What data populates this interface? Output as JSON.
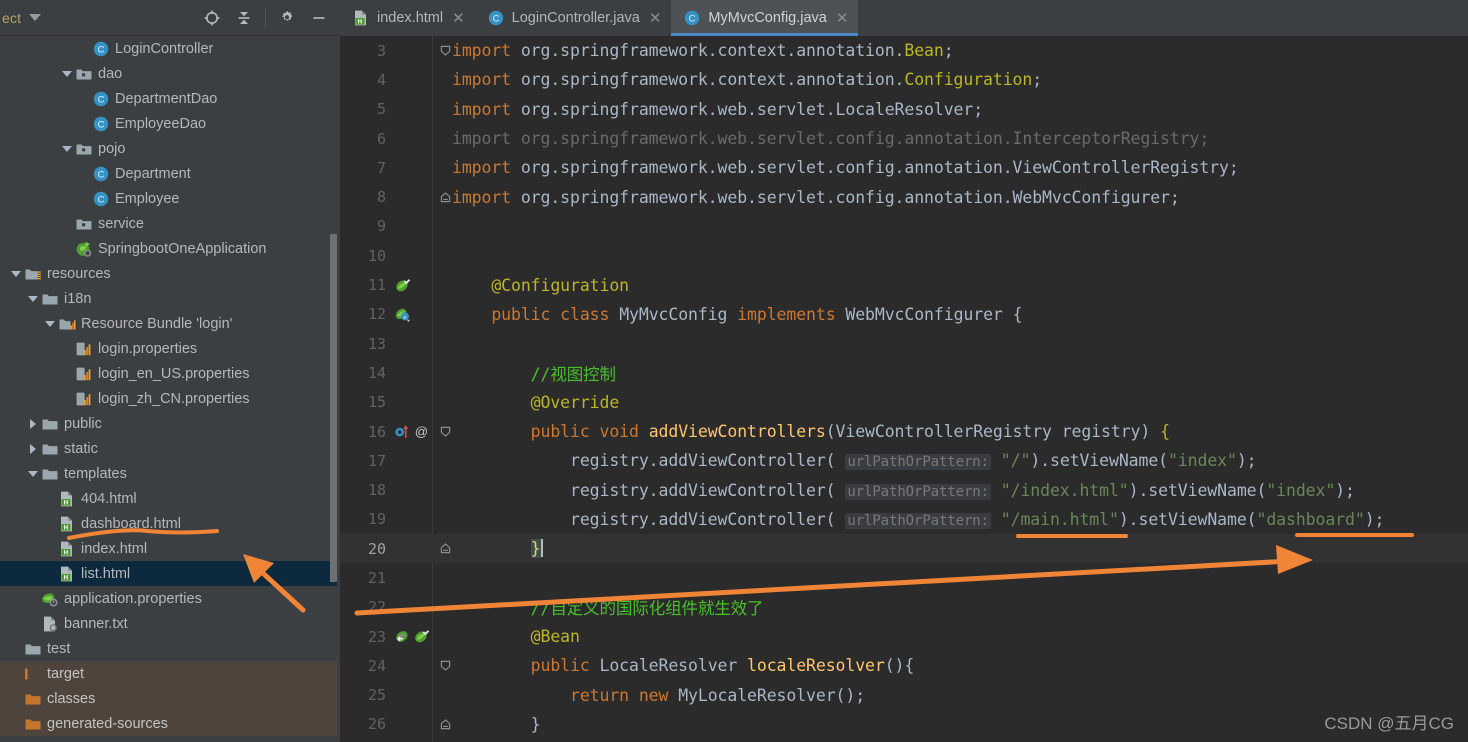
{
  "toolbar": {
    "project_label": "ect",
    "icons": [
      {
        "name": "locate-target-icon",
        "glyph": "locate"
      },
      {
        "name": "collapse-all-icon",
        "glyph": "collapse"
      },
      {
        "name": "settings-gear-icon",
        "glyph": "gear"
      },
      {
        "name": "minimize-icon",
        "glyph": "minimize"
      }
    ]
  },
  "sidebar": {
    "items": [
      {
        "label": "LoginController",
        "indent": 4,
        "twisty": "none",
        "icon": "java-class-icon",
        "state": "normal"
      },
      {
        "label": "dao",
        "indent": 3,
        "twisty": "open",
        "icon": "package-folder-icon",
        "state": "normal"
      },
      {
        "label": "DepartmentDao",
        "indent": 4,
        "twisty": "none",
        "icon": "java-class-icon",
        "state": "normal"
      },
      {
        "label": "EmployeeDao",
        "indent": 4,
        "twisty": "none",
        "icon": "java-class-icon",
        "state": "normal"
      },
      {
        "label": "pojo",
        "indent": 3,
        "twisty": "open",
        "icon": "package-folder-icon",
        "state": "normal"
      },
      {
        "label": "Department",
        "indent": 4,
        "twisty": "none",
        "icon": "java-class-icon",
        "state": "normal"
      },
      {
        "label": "Employee",
        "indent": 4,
        "twisty": "none",
        "icon": "java-class-icon",
        "state": "normal"
      },
      {
        "label": "service",
        "indent": 3,
        "twisty": "none",
        "icon": "package-folder-icon",
        "state": "normal"
      },
      {
        "label": "SpringbootOneApplication",
        "indent": 3,
        "twisty": "none",
        "icon": "spring-app-icon",
        "state": "normal"
      },
      {
        "label": "resources",
        "indent": 0,
        "twisty": "open",
        "icon": "resources-folder-icon",
        "state": "normal"
      },
      {
        "label": "i18n",
        "indent": 1,
        "twisty": "open",
        "icon": "folder-icon",
        "state": "normal"
      },
      {
        "label": "Resource Bundle 'login'",
        "indent": 2,
        "twisty": "open",
        "icon": "resource-bundle-icon",
        "state": "normal"
      },
      {
        "label": "login.properties",
        "indent": 3,
        "twisty": "none",
        "icon": "properties-file-icon",
        "state": "normal"
      },
      {
        "label": "login_en_US.properties",
        "indent": 3,
        "twisty": "none",
        "icon": "properties-file-icon",
        "state": "normal"
      },
      {
        "label": "login_zh_CN.properties",
        "indent": 3,
        "twisty": "none",
        "icon": "properties-file-icon",
        "state": "normal"
      },
      {
        "label": "public",
        "indent": 1,
        "twisty": "closed",
        "icon": "folder-icon",
        "state": "normal"
      },
      {
        "label": "static",
        "indent": 1,
        "twisty": "closed",
        "icon": "folder-icon",
        "state": "normal"
      },
      {
        "label": "templates",
        "indent": 1,
        "twisty": "open",
        "icon": "folder-icon",
        "state": "normal"
      },
      {
        "label": "404.html",
        "indent": 2,
        "twisty": "none",
        "icon": "html-file-icon",
        "state": "normal"
      },
      {
        "label": "dashboard.html",
        "indent": 2,
        "twisty": "none",
        "icon": "html-file-icon",
        "state": "normal"
      },
      {
        "label": "index.html",
        "indent": 2,
        "twisty": "none",
        "icon": "html-file-icon",
        "state": "normal"
      },
      {
        "label": "list.html",
        "indent": 2,
        "twisty": "none",
        "icon": "html-file-icon",
        "state": "selected"
      },
      {
        "label": "application.properties",
        "indent": 1,
        "twisty": "none",
        "icon": "spring-properties-icon",
        "state": "normal"
      },
      {
        "label": "banner.txt",
        "indent": 1,
        "twisty": "none",
        "icon": "text-file-icon",
        "state": "normal"
      },
      {
        "label": "test",
        "indent": 0,
        "twisty": "none",
        "icon": "folder-icon",
        "state": "normal"
      },
      {
        "label": "target",
        "indent": -1,
        "twisty": "none",
        "icon": "excluded-folder-icon",
        "state": "excluded"
      },
      {
        "label": "classes",
        "indent": 0,
        "twisty": "none",
        "icon": "orange-folder-icon",
        "state": "excluded"
      },
      {
        "label": "generated-sources",
        "indent": 0,
        "twisty": "none",
        "icon": "orange-folder-icon",
        "state": "excluded"
      }
    ]
  },
  "tabs": [
    {
      "label": "index.html",
      "icon": "html-file-icon",
      "active": false
    },
    {
      "label": "LoginController.java",
      "icon": "java-class-icon",
      "active": false
    },
    {
      "label": "MyMvcConfig.java",
      "icon": "java-class-icon",
      "active": true
    }
  ],
  "editor": {
    "active_file": "MyMvcConfig.java",
    "caret_line": 20,
    "lines": [
      {
        "n": "3",
        "fold": "start",
        "gutter": [],
        "caret": false,
        "tokens": [
          {
            "t": "import ",
            "c": "kw"
          },
          {
            "t": "org.springframework.context.annotation.",
            "c": "cls"
          },
          {
            "t": "Bean",
            "c": "ann"
          },
          {
            "t": ";",
            "c": "cls"
          }
        ]
      },
      {
        "n": "4",
        "fold": "none",
        "gutter": [],
        "caret": false,
        "tokens": [
          {
            "t": "import ",
            "c": "kw"
          },
          {
            "t": "org.springframework.context.annotation.",
            "c": "cls"
          },
          {
            "t": "Configuration",
            "c": "ann"
          },
          {
            "t": ";",
            "c": "cls"
          }
        ]
      },
      {
        "n": "5",
        "fold": "none",
        "gutter": [],
        "caret": false,
        "tokens": [
          {
            "t": "import ",
            "c": "kw"
          },
          {
            "t": "org.springframework.web.servlet.LocaleResolver;",
            "c": "cls"
          }
        ]
      },
      {
        "n": "6",
        "fold": "none",
        "gutter": [],
        "caret": false,
        "tokens": [
          {
            "t": "import org.springframework.web.servlet.config.annotation.InterceptorRegistry;",
            "c": "dim"
          }
        ]
      },
      {
        "n": "7",
        "fold": "none",
        "gutter": [],
        "caret": false,
        "tokens": [
          {
            "t": "import ",
            "c": "kw"
          },
          {
            "t": "org.springframework.web.servlet.config.annotation.ViewControllerRegistry;",
            "c": "cls"
          }
        ]
      },
      {
        "n": "8",
        "fold": "end",
        "gutter": [],
        "caret": false,
        "tokens": [
          {
            "t": "import ",
            "c": "kw"
          },
          {
            "t": "org.springframework.web.servlet.config.annotation.WebMvcConfigurer;",
            "c": "cls"
          }
        ]
      },
      {
        "n": "9",
        "fold": "none",
        "gutter": [],
        "caret": false,
        "tokens": []
      },
      {
        "n": "10",
        "fold": "none",
        "gutter": [],
        "caret": false,
        "tokens": []
      },
      {
        "n": "11",
        "fold": "none",
        "gutter": [
          "bean-check-icon"
        ],
        "caret": false,
        "tokens": [
          {
            "t": "    ",
            "c": "cls"
          },
          {
            "t": "@Configuration",
            "c": "ann"
          }
        ]
      },
      {
        "n": "12",
        "fold": "none",
        "gutter": [
          "bean-navigate-icon"
        ],
        "caret": false,
        "tokens": [
          {
            "t": "    ",
            "c": "cls"
          },
          {
            "t": "public class ",
            "c": "kw"
          },
          {
            "t": "MyMvcConfig ",
            "c": "cls"
          },
          {
            "t": "implements ",
            "c": "kw"
          },
          {
            "t": "WebMvcConfigurer {",
            "c": "cls"
          }
        ]
      },
      {
        "n": "13",
        "fold": "none",
        "gutter": [],
        "caret": false,
        "tokens": []
      },
      {
        "n": "14",
        "fold": "none",
        "gutter": [],
        "caret": false,
        "tokens": [
          {
            "t": "        ",
            "c": "cls"
          },
          {
            "t": "//视图控制",
            "c": "cmt-green"
          }
        ]
      },
      {
        "n": "15",
        "fold": "none",
        "gutter": [],
        "caret": false,
        "tokens": [
          {
            "t": "        ",
            "c": "cls"
          },
          {
            "t": "@Override",
            "c": "ann"
          }
        ]
      },
      {
        "n": "16",
        "fold": "start",
        "gutter": [
          "override-method-icon",
          "at-annotation-icon"
        ],
        "caret": false,
        "tokens": [
          {
            "t": "        ",
            "c": "cls"
          },
          {
            "t": "public void ",
            "c": "kw"
          },
          {
            "t": "addViewControllers",
            "c": "fn"
          },
          {
            "t": "(ViewControllerRegistry registry) ",
            "c": "cls"
          },
          {
            "t": "{",
            "c": "ann"
          }
        ]
      },
      {
        "n": "17",
        "fold": "none",
        "gutter": [],
        "caret": false,
        "tokens": [
          {
            "t": "            registry.addViewController( ",
            "c": "cls"
          },
          {
            "t": "urlPathOrPattern:",
            "c": "hint"
          },
          {
            "t": " ",
            "c": "cls"
          },
          {
            "t": "\"/\"",
            "c": "str"
          },
          {
            "t": ").setViewName(",
            "c": "cls"
          },
          {
            "t": "\"index\"",
            "c": "str"
          },
          {
            "t": ");",
            "c": "cls"
          }
        ]
      },
      {
        "n": "18",
        "fold": "none",
        "gutter": [],
        "caret": false,
        "tokens": [
          {
            "t": "            registry.addViewController( ",
            "c": "cls"
          },
          {
            "t": "urlPathOrPattern:",
            "c": "hint"
          },
          {
            "t": " ",
            "c": "cls"
          },
          {
            "t": "\"/index.html\"",
            "c": "str"
          },
          {
            "t": ").setViewName(",
            "c": "cls"
          },
          {
            "t": "\"index\"",
            "c": "str"
          },
          {
            "t": ");",
            "c": "cls"
          }
        ]
      },
      {
        "n": "19",
        "fold": "none",
        "gutter": [],
        "caret": false,
        "tokens": [
          {
            "t": "            registry.addViewController( ",
            "c": "cls"
          },
          {
            "t": "urlPathOrPattern:",
            "c": "hint"
          },
          {
            "t": " ",
            "c": "cls"
          },
          {
            "t": "\"/main.html\"",
            "c": "str"
          },
          {
            "t": ").setViewName(",
            "c": "cls"
          },
          {
            "t": "\"dashboard\"",
            "c": "str"
          },
          {
            "t": ");",
            "c": "cls"
          }
        ]
      },
      {
        "n": "20",
        "fold": "end",
        "gutter": [],
        "caret": true,
        "tokens": [
          {
            "t": "        ",
            "c": "cls"
          },
          {
            "t": "}",
            "c": "brace-hl"
          },
          {
            "t": "",
            "c": "caret"
          }
        ]
      },
      {
        "n": "21",
        "fold": "none",
        "gutter": [],
        "caret": false,
        "tokens": []
      },
      {
        "n": "22",
        "fold": "none",
        "gutter": [],
        "caret": false,
        "tokens": [
          {
            "t": "        ",
            "c": "cls"
          },
          {
            "t": "//自定义的国际化组件就生效了",
            "c": "cmt-green"
          }
        ]
      },
      {
        "n": "23",
        "fold": "none",
        "gutter": [
          "bean-return-icon",
          "bean-check-icon"
        ],
        "caret": false,
        "tokens": [
          {
            "t": "        ",
            "c": "cls"
          },
          {
            "t": "@Bean",
            "c": "ann"
          }
        ]
      },
      {
        "n": "24",
        "fold": "start",
        "gutter": [],
        "caret": false,
        "tokens": [
          {
            "t": "        ",
            "c": "cls"
          },
          {
            "t": "public ",
            "c": "kw"
          },
          {
            "t": "LocaleResolver ",
            "c": "cls"
          },
          {
            "t": "localeResolver",
            "c": "fn"
          },
          {
            "t": "(){",
            "c": "cls"
          }
        ]
      },
      {
        "n": "25",
        "fold": "none",
        "gutter": [],
        "caret": false,
        "tokens": [
          {
            "t": "            ",
            "c": "cls"
          },
          {
            "t": "return new ",
            "c": "kw"
          },
          {
            "t": "MyLocaleResolver();",
            "c": "cls"
          }
        ]
      },
      {
        "n": "26",
        "fold": "end",
        "gutter": [],
        "caret": false,
        "tokens": [
          {
            "t": "        ",
            "c": "cls"
          },
          {
            "t": "}",
            "c": "cls"
          }
        ]
      }
    ]
  },
  "annotations": {
    "color": "#F08437",
    "items": [
      {
        "name": "underline-dashboard-html-sidebar",
        "type": "underline"
      },
      {
        "name": "arrow-to-list-html",
        "type": "arrow"
      },
      {
        "name": "underline-main-html",
        "type": "underline"
      },
      {
        "name": "underline-dashboard-string",
        "type": "underline"
      },
      {
        "name": "arrow-to-dashboard-string",
        "type": "arrow"
      }
    ]
  },
  "watermark": {
    "text": "CSDN @五月CG"
  }
}
